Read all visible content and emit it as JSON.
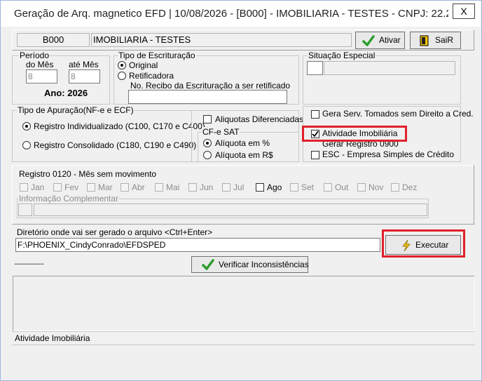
{
  "window": {
    "title": "Geração de Arq. magnetico EFD |  10/08/2026 - [B000] - IMOBILIARIA - TESTES - CNPJ: 22.22...",
    "close_label": "X"
  },
  "header": {
    "code": "B000",
    "name": "IMOBILIARIA - TESTES",
    "ativar_label": "Ativar",
    "sair_label": "SaiR"
  },
  "periodo": {
    "title": "Período",
    "do_mes_label": "do Mês",
    "do_mes_value": "8",
    "ate_mes_label": "até Mês",
    "ate_mes_value": "8",
    "ano_label": "Ano: 2026"
  },
  "escrituracao": {
    "title": "Tipo de Escrituração",
    "original_label": "Original",
    "retificadora_label": "Retificadora",
    "recibo_label": "No. Recibo da Escrituração a ser retificado",
    "recibo_value": ""
  },
  "situacao": {
    "title": "Situação Especial",
    "code_value": "",
    "desc_value": ""
  },
  "apuracao": {
    "title": "Tipo de Apuração(NF-e e ECF)",
    "individualizado_label": "Registro Individualizado (C100, C170 e C400)",
    "consolidado_label": "Registro Consolidado (C180, C190 e C490)",
    "aliquotas_label": "Aliquotas Diferenciadas",
    "cfe_title": "CF-e SAT",
    "aliquota_pct_label": "Alíquota em %",
    "aliquota_rs_label": "Alíquota em R$"
  },
  "options": {
    "gera_serv_label": "Gera Serv. Tomados sem Direito a Cred.",
    "atividade_label": "Atividade Imobiliária",
    "gerar_0900_label": "Gerar Registro 0900",
    "esc_label": "ESC - Empresa Simples de Crédito"
  },
  "registro0120": {
    "title": "Registro 0120 - Mês sem movimento",
    "months": [
      "Jan",
      "Fev",
      "Mar",
      "Abr",
      "Mai",
      "Jun",
      "Jul",
      "Ago",
      "Set",
      "Out",
      "Nov",
      "Dez"
    ],
    "info_label": "Informação Complementar",
    "info_code": "",
    "info_value": ""
  },
  "diretorio": {
    "label": "Diretório onde  vai ser gerado o  arquivo <Ctrl+Enter>",
    "path": "F:\\PHOENIX_CindyConrado\\EFDSPED",
    "executar_label": "Executar"
  },
  "verificar_label": "Verificar Inconsistências",
  "progress_dots": "..................",
  "status_text": "Atividade Imobiliária",
  "colors": {
    "highlight": "#e0202a",
    "check_green": "#2e9e2e",
    "bolt_yellow": "#f2c200"
  }
}
